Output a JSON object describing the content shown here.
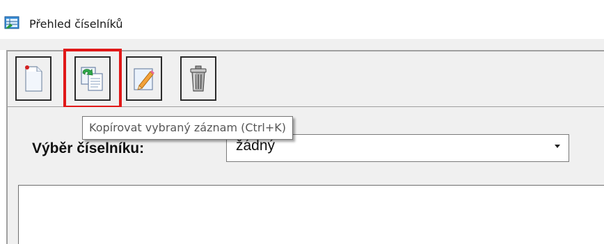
{
  "window": {
    "title": "Přehled číselníků",
    "icon": "grid-table-icon"
  },
  "toolbar": {
    "buttons": [
      {
        "name": "new-record-button",
        "icon": "new-document-icon",
        "tooltip": ""
      },
      {
        "name": "copy-record-button",
        "icon": "copy-record-icon",
        "tooltip": "Kopírovat vybraný záznam (Ctrl+K)",
        "highlighted": true
      },
      {
        "name": "edit-record-button",
        "icon": "edit-pencil-icon",
        "tooltip": ""
      },
      {
        "name": "delete-record-button",
        "icon": "trash-can-icon",
        "tooltip": ""
      }
    ],
    "active_tooltip": "Kopírovat vybraný záznam (Ctrl+K)"
  },
  "form": {
    "select_label": "Výběr číselníku:",
    "select_value": "žádný"
  },
  "colors": {
    "highlight": "#e01818",
    "panel": "#f0f0f0",
    "border": "#a0a0a0"
  }
}
